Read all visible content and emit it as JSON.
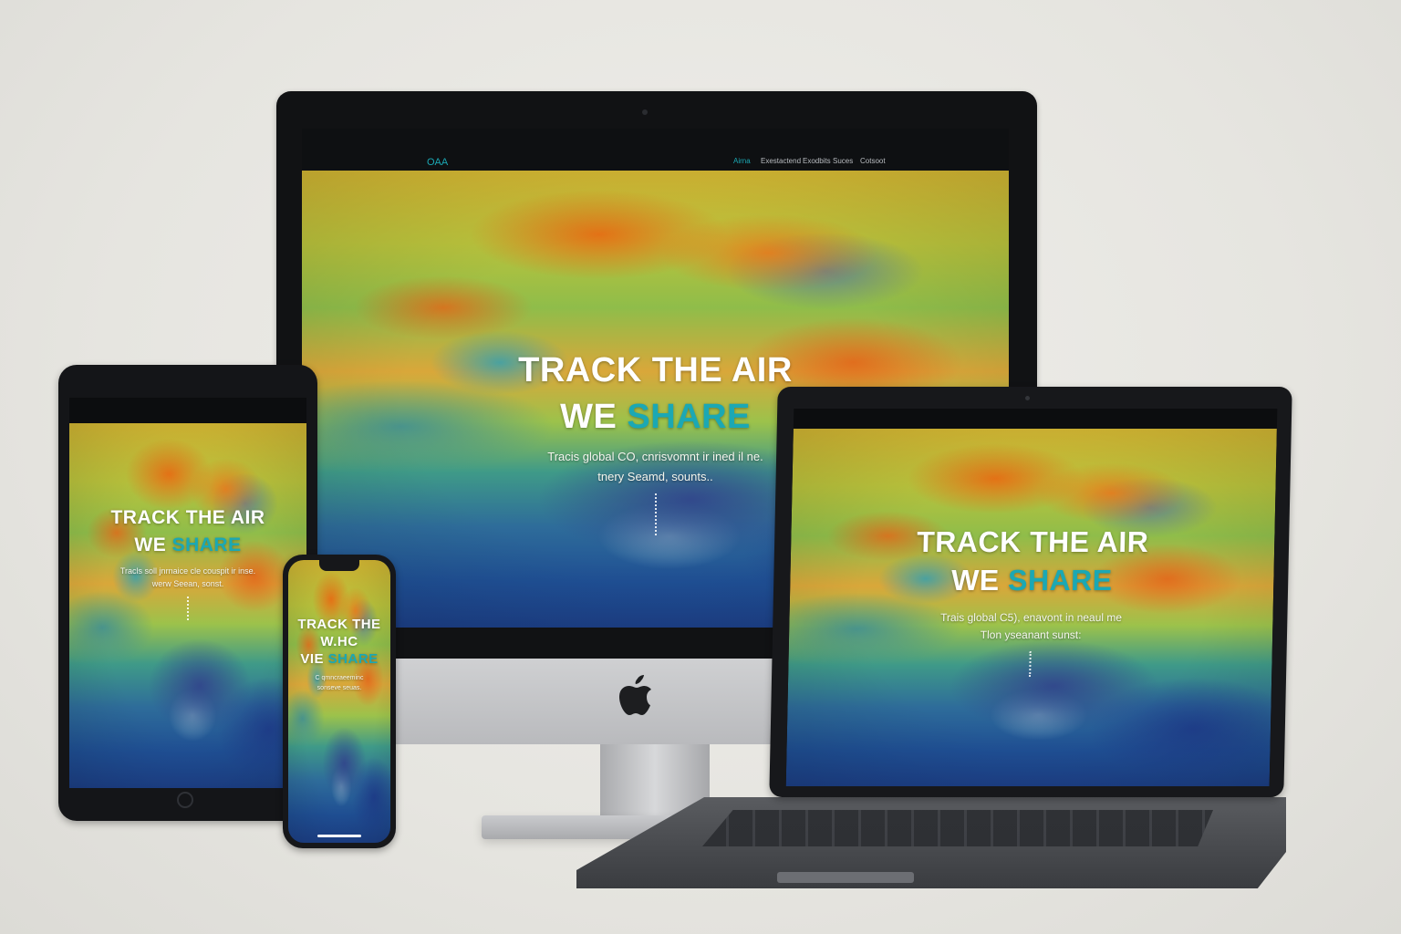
{
  "colors": {
    "accent": "#1ba8b4",
    "background": "#e8e7e2",
    "device_frame": "#141518"
  },
  "desktop": {
    "nav": {
      "logo": "OAA",
      "links": [
        "Airna",
        "Exestactend",
        "Exodbits",
        "Suces",
        "Cotsoot"
      ]
    },
    "hero": {
      "line1": "TRACK THE AIR",
      "line2_prefix": "WE",
      "line2_accent": "SHARE",
      "sub_line1": "Tracis global CO, cnrisvomnt ir ined il ne.",
      "sub_line2": "tnery Seamd, sounts..",
      "tick": "ı|ı."
    }
  },
  "tablet": {
    "hero": {
      "line1": "TRACK THE AIR",
      "line2_prefix": "WE",
      "line2_accent": "SHARE",
      "sub_line1": "Tracls soll jnrnaice cle couspit ir inse.",
      "sub_line2": "werw Seean, sonst.",
      "tick": "ı|ı."
    }
  },
  "laptop": {
    "hero": {
      "line1": "TRACK THE AIR",
      "line2_prefix": "WE",
      "line2_accent": "SHARE",
      "sub_line1": "Trais global C5), enavont in neaul me",
      "sub_line2": "Tlon yseanant sunst:",
      "tick": "ı|ı."
    }
  },
  "phone": {
    "hero": {
      "line1": "TRACK THE",
      "line2": "W.HC",
      "line3_prefix": "VIE",
      "line3_accent": "SHARE",
      "sub_line1": "C qmncraeeminc",
      "sub_line2": "sonseve seuas."
    }
  }
}
